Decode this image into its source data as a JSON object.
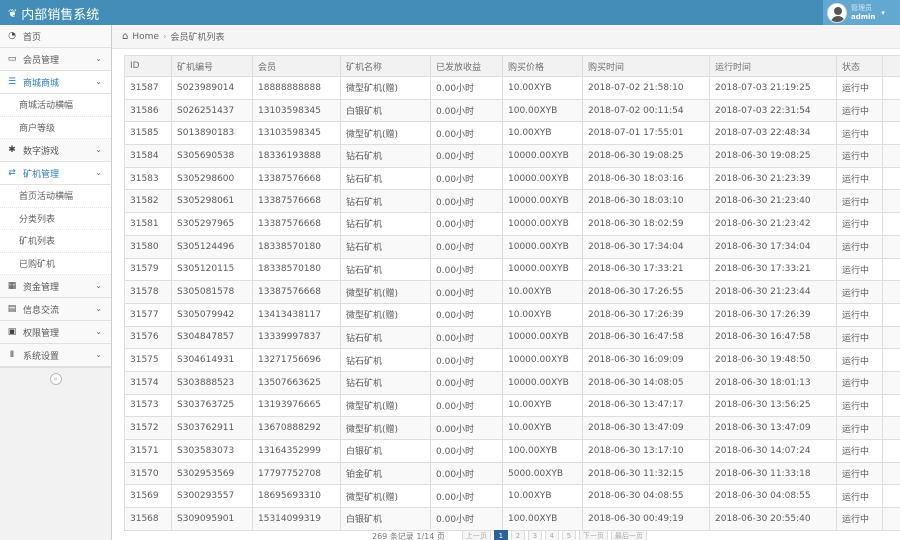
{
  "app": {
    "title": "内部销售系统",
    "logo_icon": "leaf-icon"
  },
  "user": {
    "role": "管理员",
    "name": "admin"
  },
  "sidebar": {
    "items": [
      {
        "label": "首页",
        "icon": "dashboard-icon",
        "arrow": false,
        "open": false
      },
      {
        "label": "会员管理",
        "icon": "desktop-icon",
        "arrow": true,
        "open": false
      },
      {
        "label": "商城商城",
        "icon": "list-icon",
        "arrow": true,
        "open": true,
        "children": [
          "商城活动横幅",
          "商户等级"
        ]
      },
      {
        "label": "数字游戏",
        "icon": "gear-icon",
        "arrow": true,
        "open": false
      },
      {
        "label": "矿机管理",
        "icon": "shuffle-icon",
        "arrow": true,
        "open": true,
        "children": [
          "首页活动横幅",
          "分类列表",
          "矿机列表",
          "已购矿机"
        ]
      },
      {
        "label": "资金管理",
        "icon": "calendar-icon",
        "arrow": true,
        "open": false
      },
      {
        "label": "信息交流",
        "icon": "doc-icon",
        "arrow": true,
        "open": false
      },
      {
        "label": "权限管理",
        "icon": "lock-icon",
        "arrow": true,
        "open": false
      },
      {
        "label": "系统设置",
        "icon": "text-height-icon",
        "arrow": true,
        "open": false
      }
    ]
  },
  "breadcrumb": {
    "home": "Home",
    "current": "会员矿机列表"
  },
  "table": {
    "headers": [
      "ID",
      "矿机编号",
      "会员",
      "矿机名称",
      "已发放收益",
      "购买价格",
      "购买时间",
      "运行时间",
      "状态",
      ""
    ],
    "rows": [
      [
        "31587",
        "S023989014",
        "18888888888",
        "微型矿机(赠)",
        "0.00小时",
        "10.00XYB",
        "2018-07-02 21:58:10",
        "2018-07-03 21:19:25",
        "运行中"
      ],
      [
        "31586",
        "S026251437",
        "13103598345",
        "白银矿机",
        "0.00小时",
        "100.00XYB",
        "2018-07-02 00:11:54",
        "2018-07-03 22:31:54",
        "运行中"
      ],
      [
        "31585",
        "S013890183",
        "13103598345",
        "微型矿机(赠)",
        "0.00小时",
        "10.00XYB",
        "2018-07-01 17:55:01",
        "2018-07-03 22:48:34",
        "运行中"
      ],
      [
        "31584",
        "S305690538",
        "18336193888",
        "钻石矿机",
        "0.00小时",
        "10000.00XYB",
        "2018-06-30 19:08:25",
        "2018-06-30 19:08:25",
        "运行中"
      ],
      [
        "31583",
        "S305298600",
        "13387576668",
        "钻石矿机",
        "0.00小时",
        "10000.00XYB",
        "2018-06-30 18:03:16",
        "2018-06-30 21:23:39",
        "运行中"
      ],
      [
        "31582",
        "S305298061",
        "13387576668",
        "钻石矿机",
        "0.00小时",
        "10000.00XYB",
        "2018-06-30 18:03:10",
        "2018-06-30 21:23:40",
        "运行中"
      ],
      [
        "31581",
        "S305297965",
        "13387576668",
        "钻石矿机",
        "0.00小时",
        "10000.00XYB",
        "2018-06-30 18:02:59",
        "2018-06-30 21:23:42",
        "运行中"
      ],
      [
        "31580",
        "S305124496",
        "18338570180",
        "钻石矿机",
        "0.00小时",
        "10000.00XYB",
        "2018-06-30 17:34:04",
        "2018-06-30 17:34:04",
        "运行中"
      ],
      [
        "31579",
        "S305120115",
        "18338570180",
        "钻石矿机",
        "0.00小时",
        "10000.00XYB",
        "2018-06-30 17:33:21",
        "2018-06-30 17:33:21",
        "运行中"
      ],
      [
        "31578",
        "S305081578",
        "13387576668",
        "微型矿机(赠)",
        "0.00小时",
        "10.00XYB",
        "2018-06-30 17:26:55",
        "2018-06-30 21:23:44",
        "运行中"
      ],
      [
        "31577",
        "S305079942",
        "13413438117",
        "微型矿机(赠)",
        "0.00小时",
        "10.00XYB",
        "2018-06-30 17:26:39",
        "2018-06-30 17:26:39",
        "运行中"
      ],
      [
        "31576",
        "S304847857",
        "13339997837",
        "钻石矿机",
        "0.00小时",
        "10000.00XYB",
        "2018-06-30 16:47:58",
        "2018-06-30 16:47:58",
        "运行中"
      ],
      [
        "31575",
        "S304614931",
        "13271756696",
        "钻石矿机",
        "0.00小时",
        "10000.00XYB",
        "2018-06-30 16:09:09",
        "2018-06-30 19:48:50",
        "运行中"
      ],
      [
        "31574",
        "S303888523",
        "13507663625",
        "钻石矿机",
        "0.00小时",
        "10000.00XYB",
        "2018-06-30 14:08:05",
        "2018-06-30 18:01:13",
        "运行中"
      ],
      [
        "31573",
        "S303763725",
        "13193976665",
        "微型矿机(赠)",
        "0.00小时",
        "10.00XYB",
        "2018-06-30 13:47:17",
        "2018-06-30 13:56:25",
        "运行中"
      ],
      [
        "31572",
        "S303762911",
        "13670888292",
        "微型矿机(赠)",
        "0.00小时",
        "10.00XYB",
        "2018-06-30 13:47:09",
        "2018-06-30 13:47:09",
        "运行中"
      ],
      [
        "31571",
        "S303583073",
        "13164352999",
        "白银矿机",
        "0.00小时",
        "100.00XYB",
        "2018-06-30 13:17:10",
        "2018-06-30 14:07:24",
        "运行中"
      ],
      [
        "31570",
        "S302953569",
        "17797752708",
        "铂金矿机",
        "0.00小时",
        "5000.00XYB",
        "2018-06-30 11:32:15",
        "2018-06-30 11:33:18",
        "运行中"
      ],
      [
        "31569",
        "S300293557",
        "18695693310",
        "微型矿机(赠)",
        "0.00小时",
        "10.00XYB",
        "2018-06-30 04:08:55",
        "2018-06-30 04:08:55",
        "运行中"
      ],
      [
        "31568",
        "S309095901",
        "15314099319",
        "白银矿机",
        "0.00小时",
        "100.00XYB",
        "2018-06-30 00:49:19",
        "2018-06-30 20:55:40",
        "运行中"
      ]
    ]
  },
  "pagination": {
    "summary": "269 条记录 1/14 页",
    "prev": "上一页",
    "pages": [
      "1",
      "2",
      "3",
      "4",
      "5"
    ],
    "active": "1",
    "next": "下一页",
    "last": "最后一页"
  }
}
